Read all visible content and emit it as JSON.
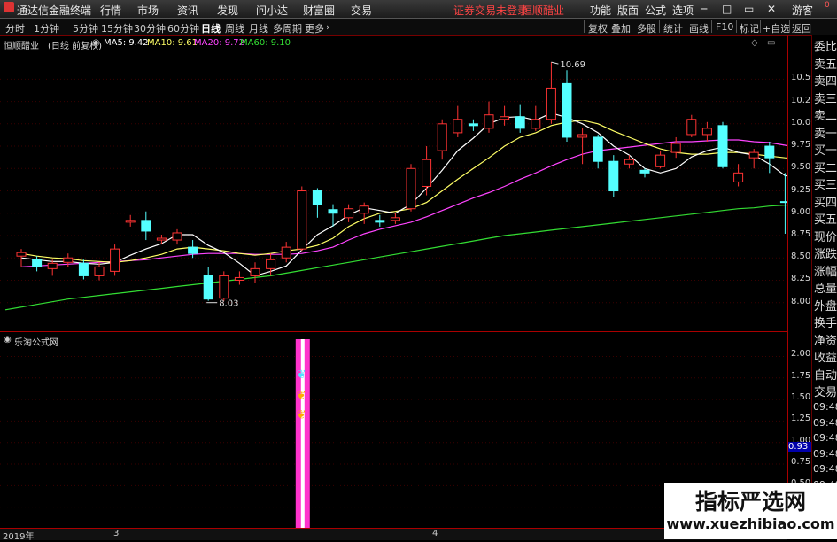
{
  "menubar": {
    "app_title": "通达信金融终端",
    "menus": [
      "行情",
      "市场",
      "资讯",
      "发现",
      "问小达",
      "财富圈",
      "交易"
    ],
    "notice": "证券交易未登录",
    "broker": "恒顺醋业",
    "right_menus": [
      "功能",
      "版面",
      "公式",
      "选项"
    ],
    "guest": "游客",
    "corner": "0"
  },
  "toolbar": {
    "periods": [
      "分时",
      "1分钟",
      "5分钟",
      "15分钟",
      "30分钟",
      "60分钟",
      "日线",
      "周线",
      "月线",
      "多周期",
      "更多"
    ],
    "active_period": "日线",
    "actions": [
      "复权",
      "叠加",
      "多股",
      "统计",
      "画线",
      "F10",
      "标记",
      "+自选",
      "返回"
    ]
  },
  "chart_header": {
    "stock": "恒顺醋业",
    "mode": "(日线 前复权)",
    "ma5": "MA5: 9.42",
    "ma10": "MA10: 9.61",
    "ma20": "MA20: 9.72",
    "ma60": "MA60: 9.10"
  },
  "indicator_header": {
    "name": "乐淘公式网"
  },
  "axis": {
    "price_ticks": [
      "10.50",
      "10.25",
      "10.00",
      "9.75",
      "9.50",
      "9.25",
      "9.00",
      "8.75",
      "8.50",
      "8.25",
      "8.00"
    ],
    "indicator_ticks": [
      "2.00",
      "1.75",
      "1.50",
      "1.25",
      "1.00",
      "0.75",
      "0.50",
      "0.25"
    ],
    "current_value": "0.93"
  },
  "bottom": {
    "year_label": "2019年",
    "month_3": "3",
    "month_4": "4"
  },
  "right_panel": {
    "labels": [
      "委比",
      "卖五",
      "卖四",
      "卖三",
      "卖二",
      "卖一",
      "买一",
      "买二",
      "买三",
      "买四",
      "买五",
      "现价",
      "涨跌",
      "涨幅",
      "总量",
      "外盘",
      "换手",
      "净资",
      "收益",
      "自动",
      "交易"
    ],
    "times": [
      "09:48",
      "09:48",
      "09:48",
      "09:48",
      "09:48",
      "09:48",
      "09:48",
      "09:48",
      "09:48"
    ]
  },
  "watermark": {
    "title": "指标严选网",
    "url": "www.xuezhibiao.com"
  },
  "colors": {
    "up": "#ff3333",
    "down": "#54ffff",
    "ma5": "#ffffff",
    "ma10": "#ffff66",
    "ma20": "#ff44ff",
    "ma60": "#33dd33",
    "signal": "#ff33cc"
  },
  "chart_data": {
    "type": "candlestick",
    "ylim": [
      7.7,
      10.85
    ],
    "high_label": "10.69",
    "low_label": "8.03",
    "candles": [
      {
        "o": 8.52,
        "c": 8.56,
        "h": 8.6,
        "l": 8.4
      },
      {
        "o": 8.48,
        "c": 8.4,
        "h": 8.52,
        "l": 8.35
      },
      {
        "o": 8.38,
        "c": 8.44,
        "h": 8.48,
        "l": 8.3
      },
      {
        "o": 8.45,
        "c": 8.5,
        "h": 8.55,
        "l": 8.4
      },
      {
        "o": 8.44,
        "c": 8.3,
        "h": 8.48,
        "l": 8.26
      },
      {
        "o": 8.3,
        "c": 8.4,
        "h": 8.45,
        "l": 8.25
      },
      {
        "o": 8.35,
        "c": 8.6,
        "h": 8.65,
        "l": 8.3
      },
      {
        "o": 8.9,
        "c": 8.92,
        "h": 8.98,
        "l": 8.85
      },
      {
        "o": 8.92,
        "c": 8.8,
        "h": 9.02,
        "l": 8.7
      },
      {
        "o": 8.7,
        "c": 8.72,
        "h": 8.76,
        "l": 8.65
      },
      {
        "o": 8.7,
        "c": 8.78,
        "h": 8.82,
        "l": 8.65
      },
      {
        "o": 8.62,
        "c": 8.55,
        "h": 8.7,
        "l": 8.5
      },
      {
        "o": 8.3,
        "c": 8.04,
        "h": 8.4,
        "l": 8.02
      },
      {
        "o": 8.05,
        "c": 8.3,
        "h": 8.35,
        "l": 8.02
      },
      {
        "o": 8.25,
        "c": 8.28,
        "h": 8.35,
        "l": 8.2
      },
      {
        "o": 8.3,
        "c": 8.38,
        "h": 8.45,
        "l": 8.22
      },
      {
        "o": 8.38,
        "c": 8.48,
        "h": 8.55,
        "l": 8.3
      },
      {
        "o": 8.5,
        "c": 8.62,
        "h": 8.68,
        "l": 8.45
      },
      {
        "o": 8.6,
        "c": 9.25,
        "h": 9.3,
        "l": 8.58
      },
      {
        "o": 9.25,
        "c": 9.1,
        "h": 9.28,
        "l": 8.95
      },
      {
        "o": 9.04,
        "c": 9.0,
        "h": 9.1,
        "l": 8.85
      },
      {
        "o": 8.95,
        "c": 9.05,
        "h": 9.1,
        "l": 8.9
      },
      {
        "o": 9.0,
        "c": 9.08,
        "h": 9.12,
        "l": 8.88
      },
      {
        "o": 8.92,
        "c": 8.9,
        "h": 8.98,
        "l": 8.85
      },
      {
        "o": 8.92,
        "c": 8.95,
        "h": 9.0,
        "l": 8.88
      },
      {
        "o": 9.05,
        "c": 9.5,
        "h": 9.55,
        "l": 9.02
      },
      {
        "o": 9.3,
        "c": 9.6,
        "h": 9.75,
        "l": 9.2
      },
      {
        "o": 9.7,
        "c": 10.0,
        "h": 10.05,
        "l": 9.6
      },
      {
        "o": 9.9,
        "c": 10.05,
        "h": 10.2,
        "l": 9.85
      },
      {
        "o": 10.0,
        "c": 9.98,
        "h": 10.05,
        "l": 9.92
      },
      {
        "o": 9.95,
        "c": 10.1,
        "h": 10.25,
        "l": 9.9
      },
      {
        "o": 10.05,
        "c": 10.08,
        "h": 10.2,
        "l": 9.98
      },
      {
        "o": 10.08,
        "c": 9.95,
        "h": 10.22,
        "l": 9.9
      },
      {
        "o": 9.95,
        "c": 10.05,
        "h": 10.2,
        "l": 9.92
      },
      {
        "o": 10.05,
        "c": 10.4,
        "h": 10.69,
        "l": 10.0
      },
      {
        "o": 10.45,
        "c": 9.85,
        "h": 10.6,
        "l": 9.8
      },
      {
        "o": 9.85,
        "c": 9.88,
        "h": 9.95,
        "l": 9.55
      },
      {
        "o": 9.85,
        "c": 9.58,
        "h": 9.88,
        "l": 9.5
      },
      {
        "o": 9.58,
        "c": 9.25,
        "h": 9.65,
        "l": 9.18
      },
      {
        "o": 9.55,
        "c": 9.6,
        "h": 9.65,
        "l": 9.5
      },
      {
        "o": 9.48,
        "c": 9.45,
        "h": 9.5,
        "l": 9.4
      },
      {
        "o": 9.52,
        "c": 9.65,
        "h": 9.7,
        "l": 9.5
      },
      {
        "o": 9.68,
        "c": 9.78,
        "h": 9.85,
        "l": 9.62
      },
      {
        "o": 9.88,
        "c": 10.05,
        "h": 10.1,
        "l": 9.85
      },
      {
        "o": 9.88,
        "c": 9.95,
        "h": 10.02,
        "l": 9.8
      },
      {
        "o": 9.98,
        "c": 9.52,
        "h": 10.02,
        "l": 9.5
      },
      {
        "o": 9.35,
        "c": 9.45,
        "h": 9.55,
        "l": 9.3
      },
      {
        "o": 9.62,
        "c": 9.68,
        "h": 9.72,
        "l": 9.5
      },
      {
        "o": 9.75,
        "c": 9.62,
        "h": 9.8,
        "l": 9.45
      },
      {
        "o": 9.13,
        "c": 9.12,
        "h": 9.45,
        "l": 8.77
      },
      {
        "o": 9.12,
        "c": 9.45,
        "h": 9.48,
        "l": 9.1
      }
    ],
    "ma5": [
      8.5,
      8.48,
      8.46,
      8.46,
      8.44,
      8.43,
      8.45,
      8.53,
      8.6,
      8.66,
      8.76,
      8.76,
      8.64,
      8.56,
      8.44,
      8.3,
      8.35,
      8.41,
      8.59,
      8.76,
      8.86,
      8.98,
      9.06,
      9.03,
      9.0,
      9.1,
      9.28,
      9.48,
      9.7,
      9.84,
      10.0,
      10.07,
      10.08,
      10.04,
      10.12,
      10.07,
      10.0,
      9.9,
      9.75,
      9.65,
      9.5,
      9.45,
      9.5,
      9.63,
      9.7,
      9.74,
      9.68,
      9.65,
      9.55,
      9.42,
      9.4
    ],
    "ma10": [
      8.55,
      8.52,
      8.5,
      8.49,
      8.47,
      8.46,
      8.45,
      8.47,
      8.5,
      8.54,
      8.6,
      8.62,
      8.6,
      8.58,
      8.55,
      8.53,
      8.55,
      8.58,
      8.6,
      8.64,
      8.72,
      8.85,
      8.94,
      9.0,
      9.02,
      9.05,
      9.12,
      9.25,
      9.38,
      9.5,
      9.62,
      9.75,
      9.85,
      9.9,
      9.98,
      10.02,
      10.04,
      10.0,
      9.92,
      9.85,
      9.78,
      9.72,
      9.68,
      9.66,
      9.66,
      9.68,
      9.68,
      9.66,
      9.64,
      9.62,
      9.61
    ],
    "ma20": [
      8.4,
      8.41,
      8.42,
      8.43,
      8.44,
      8.45,
      8.46,
      8.47,
      8.48,
      8.5,
      8.52,
      8.54,
      8.55,
      8.55,
      8.55,
      8.54,
      8.54,
      8.54,
      8.55,
      8.58,
      8.62,
      8.7,
      8.77,
      8.82,
      8.86,
      8.9,
      8.96,
      9.03,
      9.1,
      9.17,
      9.23,
      9.3,
      9.38,
      9.45,
      9.53,
      9.6,
      9.66,
      9.7,
      9.72,
      9.74,
      9.76,
      9.78,
      9.8,
      9.8,
      9.81,
      9.82,
      9.82,
      9.8,
      9.79,
      9.76,
      9.72
    ],
    "ma60": [
      7.95,
      7.98,
      8.01,
      8.04,
      8.06,
      8.08,
      8.1,
      8.12,
      8.14,
      8.16,
      8.18,
      8.2,
      8.22,
      8.24,
      8.26,
      8.28,
      8.3,
      8.33,
      8.36,
      8.39,
      8.42,
      8.45,
      8.48,
      8.51,
      8.54,
      8.57,
      8.6,
      8.63,
      8.66,
      8.69,
      8.72,
      8.75,
      8.77,
      8.79,
      8.81,
      8.83,
      8.85,
      8.87,
      8.89,
      8.91,
      8.93,
      8.95,
      8.97,
      8.99,
      9.01,
      9.03,
      9.05,
      9.06,
      9.08,
      9.09,
      9.1
    ],
    "signal_bar_index": 18
  }
}
